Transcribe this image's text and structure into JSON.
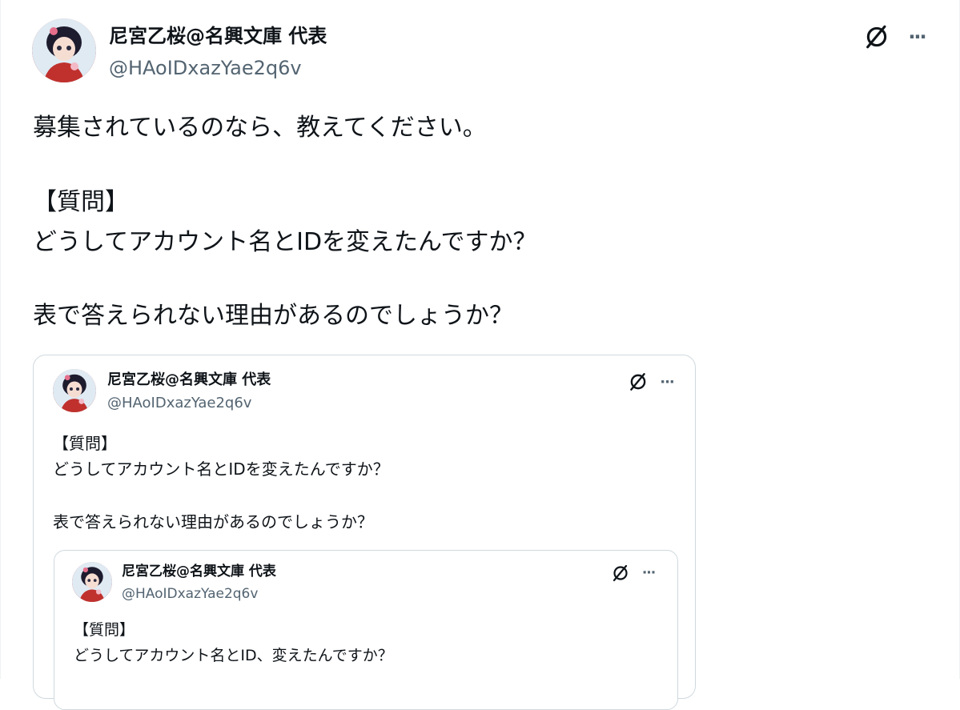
{
  "main": {
    "display_name": "尼宮乙桜@名興文庫 代表",
    "handle": "@HAoIDxazYae2q6v",
    "lines": [
      "募集されているのなら、教えてください。",
      "【質問】",
      "どうしてアカウント名とIDを変えたんですか？",
      "表で答えられない理由があるのでしょうか？"
    ],
    "more_label": "···"
  },
  "quote1": {
    "display_name": "尼宮乙桜@名興文庫 代表",
    "handle": "@HAoIDxazYae2q6v",
    "lines": [
      "【質問】",
      "どうしてアカウント名とIDを変えたんですか？",
      "表で答えられない理由があるのでしょうか？"
    ],
    "more_label": "···"
  },
  "quote2": {
    "display_name": "尼宮乙桜@名興文庫 代表",
    "handle": "@HAoIDxazYae2q6v",
    "lines": [
      "【質問】",
      "どうしてアカウント名とID、変えたんですか？"
    ],
    "more_label": "···"
  },
  "icons": {
    "grok": "slashed-circle-icon",
    "more": "more-dots-icon"
  },
  "colors": {
    "text": "#0f1419",
    "secondary": "#536471",
    "border": "#cfd9de"
  }
}
